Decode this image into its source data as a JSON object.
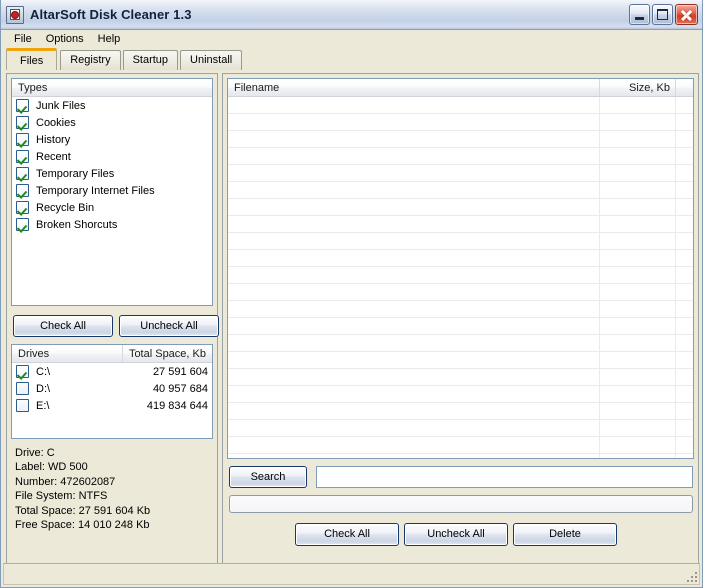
{
  "window": {
    "title": "AltarSoft Disk Cleaner 1.3",
    "icon": "disk-cleaner-icon",
    "controls": {
      "minimize": "minimize-button",
      "maximize": "maximize-button",
      "close": "close-button"
    }
  },
  "menubar": {
    "items": [
      {
        "label": "File"
      },
      {
        "label": "Options"
      },
      {
        "label": "Help"
      }
    ]
  },
  "tabs": {
    "active": "Files",
    "items": [
      {
        "label": "Files",
        "active": true
      },
      {
        "label": "Registry",
        "active": false
      },
      {
        "label": "Startup",
        "active": false
      },
      {
        "label": "Uninstall",
        "active": false
      }
    ]
  },
  "left_panel": {
    "types_list": {
      "header": "Types",
      "items": [
        {
          "label": "Junk Files",
          "checked": true
        },
        {
          "label": "Cookies",
          "checked": true
        },
        {
          "label": "History",
          "checked": true
        },
        {
          "label": "Recent",
          "checked": true
        },
        {
          "label": "Temporary Files",
          "checked": true
        },
        {
          "label": "Temporary Internet Files",
          "checked": true
        },
        {
          "label": "Recycle Bin",
          "checked": true
        },
        {
          "label": "Broken Shorcuts",
          "checked": true
        }
      ]
    },
    "check_all_label": "Check All",
    "uncheck_all_label": "Uncheck All",
    "drives_list": {
      "headers": [
        "Drives",
        "Total Space, Kb"
      ],
      "rows": [
        {
          "drive": "C:\\",
          "total_space": "27 591 604",
          "checked": true
        },
        {
          "drive": "D:\\",
          "total_space": "40 957 684",
          "checked": false
        },
        {
          "drive": "E:\\",
          "total_space": "419 834 644",
          "checked": false
        }
      ]
    },
    "drive_info": {
      "lines": [
        "Drive: C",
        "Label: WD 500",
        "Number: 472602087",
        "File System: NTFS",
        "Total Space: 27 591 604 Kb",
        "Free Space: 14 010 248 Kb"
      ],
      "text": "Drive: C\nLabel: WD 500\nNumber: 472602087\nFile System: NTFS\nTotal Space: 27 591 604 Kb\nFree Space: 14 010 248 Kb"
    }
  },
  "right_panel": {
    "files_list": {
      "headers": [
        "Filename",
        "Size, Kb",
        ""
      ],
      "rows": [],
      "empty_row_count": 22
    },
    "search_label": "Search",
    "search_value": "",
    "search_placeholder": "",
    "progress_value": 0,
    "check_all_label": "Check All",
    "uncheck_all_label": "Uncheck All",
    "delete_label": "Delete"
  },
  "statusbar": {
    "text": ""
  },
  "colors": {
    "window_face": "#ece9d8",
    "accent_tab": "#f0a30a",
    "button_border": "#17386b",
    "checkbox_check": "#1f8a1f",
    "close_button": "#cf3c22",
    "field_border": "#7f9db9"
  }
}
